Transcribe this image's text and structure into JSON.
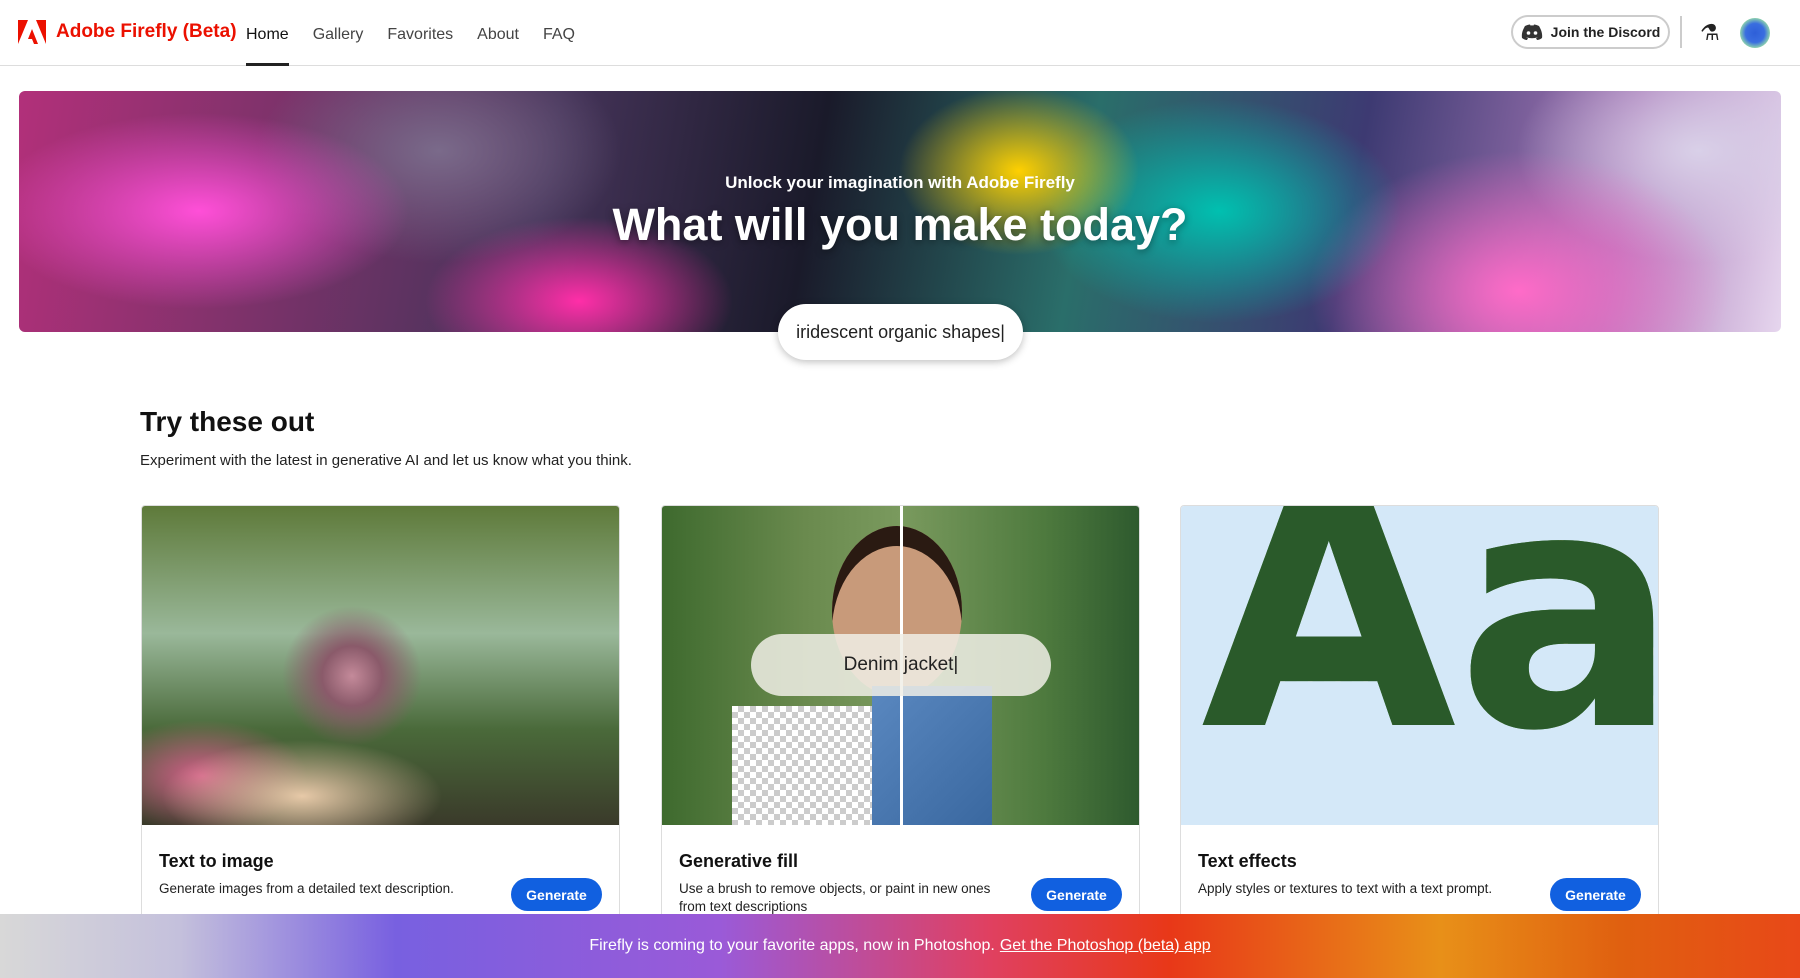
{
  "header": {
    "brand": "Adobe Firefly (Beta)",
    "tabs": [
      {
        "label": "Home",
        "active": true
      },
      {
        "label": "Gallery"
      },
      {
        "label": "Favorites"
      },
      {
        "label": "About"
      },
      {
        "label": "FAQ"
      }
    ],
    "discord_label": "Join the Discord",
    "icons": [
      "adobe-logo-icon",
      "discord-icon",
      "flask-icon",
      "avatar"
    ]
  },
  "hero": {
    "subtitle": "Unlock your imagination with Adobe Firefly",
    "title": "What will you make today?",
    "search_value": "iridescent organic shapes|"
  },
  "section": {
    "title": "Try these out",
    "subtitle": "Experiment with the latest in generative AI and let us know what you think."
  },
  "cards": [
    {
      "title": "Text to image",
      "description": "Generate images from a detailed text description.",
      "button": "Generate"
    },
    {
      "title": "Generative fill",
      "description": "Use a brush to remove objects, or paint in new ones from text descriptions",
      "button": "Generate",
      "image_prompt": "Denim jacket|"
    },
    {
      "title": "Text effects",
      "description": "Apply styles or textures to text with a text prompt.",
      "button": "Generate",
      "image_text": "Aa"
    }
  ],
  "banner": {
    "text": "Firefly is coming to your favorite apps, now in Photoshop.",
    "link": "Get the Photoshop (beta) app"
  },
  "colors": {
    "brand": "#eb1000",
    "button": "#1160e0"
  }
}
